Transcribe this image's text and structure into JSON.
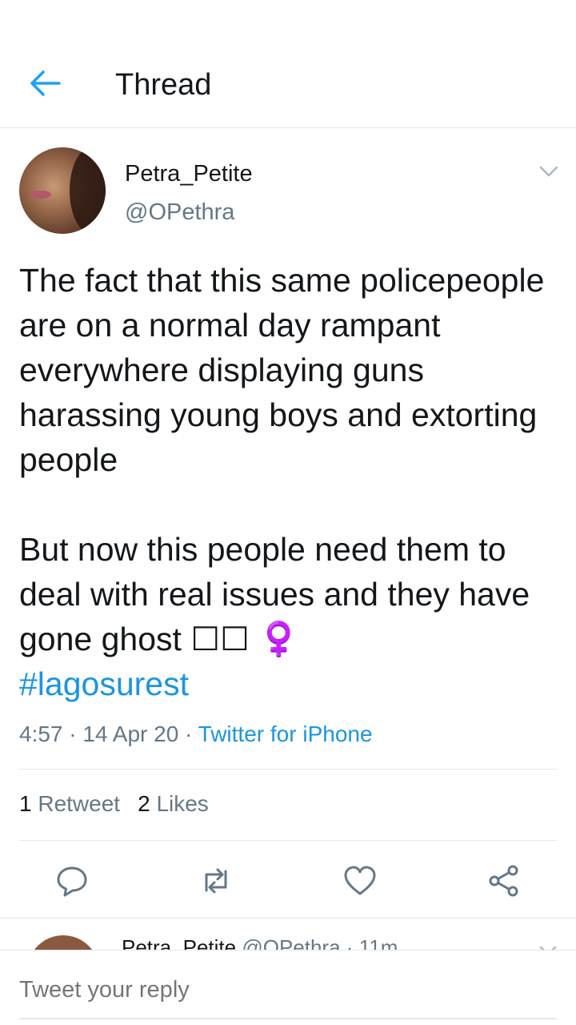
{
  "header": {
    "title": "Thread",
    "back_icon": "arrow-left-icon",
    "accent": "#1da1f2"
  },
  "tweet": {
    "display_name": "Petra_Petite",
    "handle": "@OPethra",
    "body_text": "The fact that this same policepeople are on a normal day rampant everywhere displaying guns harassing young boys and extorting people\n\nBut now this people need them to deal with real issues and they have gone ghost ☐☐ ♀️",
    "hashtag": "#lagosurest",
    "time": "4:57",
    "date": "14 Apr 20",
    "separator": "·",
    "source": "Twitter for iPhone",
    "retweet_count": "1",
    "retweet_label": "Retweet",
    "like_count": "2",
    "like_label": "Likes"
  },
  "actions": {
    "reply_icon": "reply-icon",
    "retweet_icon": "retweet-icon",
    "like_icon": "heart-icon",
    "share_icon": "share-icon"
  },
  "reply_preview": {
    "display_name": "Petra_Petite",
    "handle": "@OPethra",
    "separator": "·",
    "age": "11m"
  },
  "reply_box": {
    "placeholder": "Tweet your reply"
  },
  "colors": {
    "link": "#1b95e0",
    "muted": "#657786",
    "text": "#14171a",
    "divider": "#e1e8ed"
  }
}
